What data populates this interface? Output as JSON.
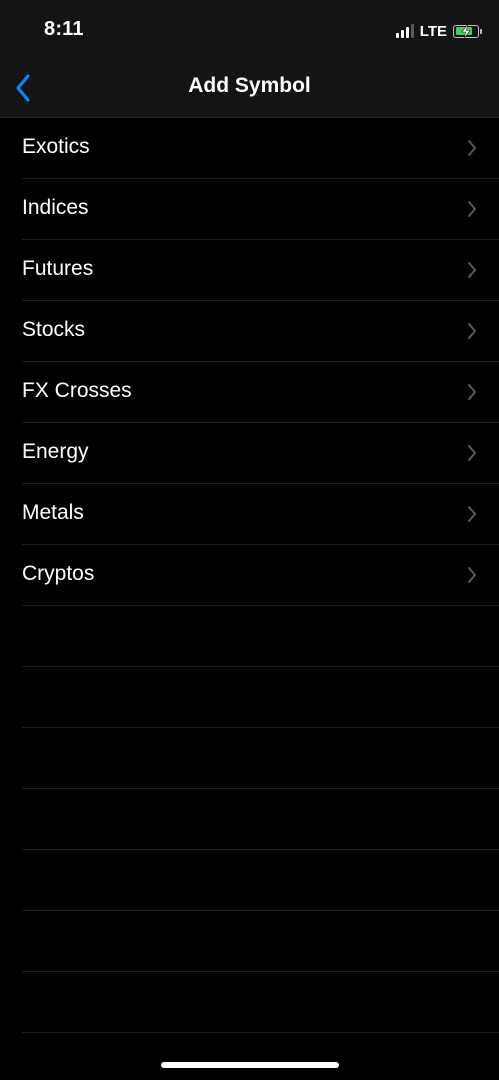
{
  "status_bar": {
    "time": "8:11",
    "network": "LTE",
    "signal_bars_active": 3,
    "signal_bars_total": 4,
    "battery_level": 0.8,
    "battery_charging": true
  },
  "nav": {
    "title": "Add Symbol",
    "back_icon": "chevron-left-icon"
  },
  "categories": [
    {
      "label": "Exotics"
    },
    {
      "label": "Indices"
    },
    {
      "label": "Futures"
    },
    {
      "label": "Stocks"
    },
    {
      "label": "FX Crosses"
    },
    {
      "label": "Energy"
    },
    {
      "label": "Metals"
    },
    {
      "label": "Cryptos"
    }
  ],
  "colors": {
    "background": "#000000",
    "nav_background": "#141414",
    "accent": "#0a84ff",
    "separator": "#1f1f1f",
    "chevron": "#5a5a5a",
    "battery": "#3fd05a"
  }
}
